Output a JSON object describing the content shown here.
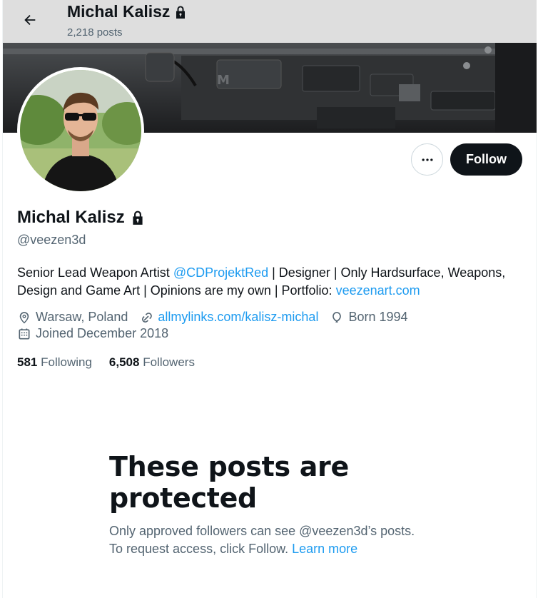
{
  "header": {
    "back_icon": "arrow-left-icon",
    "name": "Michal Kalisz",
    "posts_count": "2,218 posts",
    "lock_icon": "lock-icon"
  },
  "actions": {
    "more_icon": "ellipsis-icon",
    "follow_label": "Follow"
  },
  "profile": {
    "name": "Michal Kalisz",
    "handle": "@veezen3d",
    "bio": {
      "part1": "Senior Lead Weapon Artist ",
      "mention": "@CDProjektRed",
      "part2": " | Designer | Only Hardsurface, Weapons, Design and Game Art | Opinions are my own | Portfolio: ",
      "portfolio_link": "veezenart.com"
    },
    "location": "Warsaw, Poland",
    "website": "allmylinks.com/kalisz-michal",
    "birth": "Born 1994",
    "joined": "Joined December 2018",
    "following_count": "581",
    "following_label": "Following",
    "followers_count": "6,508",
    "followers_label": "Followers"
  },
  "protected": {
    "title": "These posts are protected",
    "text": "Only approved followers can see @veezen3d’s posts. To request access, click Follow. ",
    "learn_more": "Learn more"
  },
  "colors": {
    "accent": "#1d9bf0",
    "text_primary": "#0f1419",
    "text_secondary": "#536471",
    "follow_bg": "#0f1419"
  }
}
